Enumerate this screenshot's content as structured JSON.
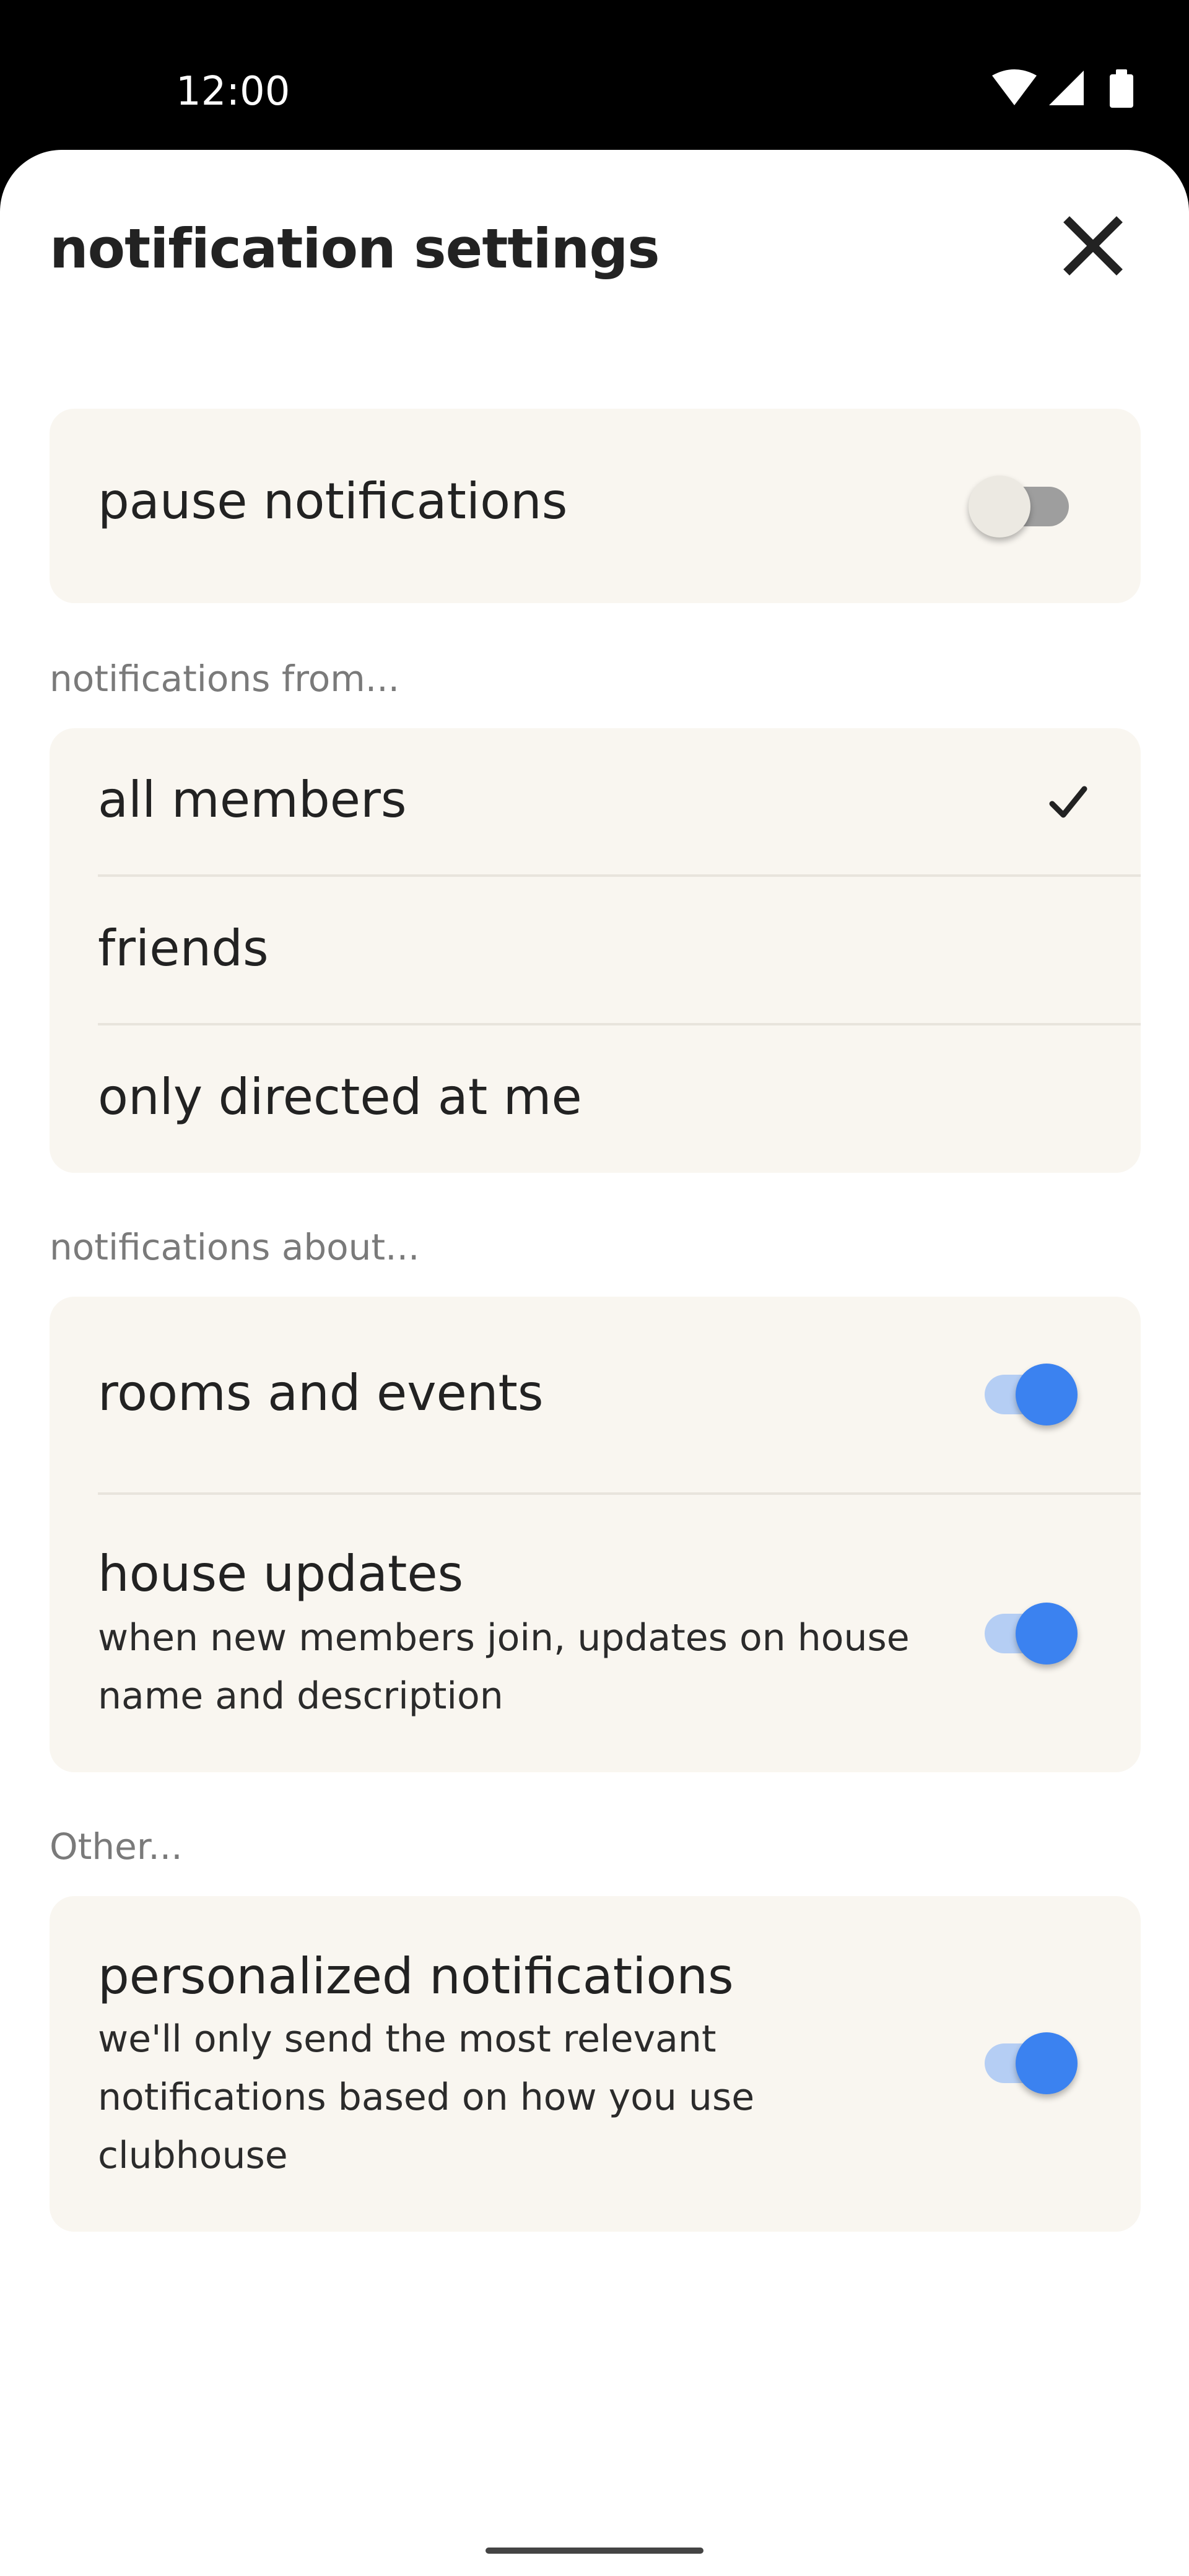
{
  "status_bar": {
    "time": "12:00",
    "icons": [
      "wifi-icon",
      "cellular-signal-icon",
      "battery-icon"
    ]
  },
  "header": {
    "title": "notification settings",
    "close_icon": "close-icon"
  },
  "pause": {
    "label": "pause notifications",
    "enabled": false
  },
  "from_section": {
    "label": "notifications from...",
    "options": [
      {
        "label": "all members",
        "selected": true
      },
      {
        "label": "friends",
        "selected": false
      },
      {
        "label": "only directed at me",
        "selected": false
      }
    ]
  },
  "about_section": {
    "label": "notifications about...",
    "items": [
      {
        "label": "rooms and events",
        "enabled": true
      },
      {
        "label": "house updates",
        "description": "when new members join, updates on house name and description",
        "enabled": true
      }
    ]
  },
  "other_section": {
    "label": "Other...",
    "items": [
      {
        "label": "personalized notifications",
        "description": "we'll only send the most relevant notifications based on how you use clubhouse",
        "enabled": true
      }
    ]
  },
  "colors": {
    "card_background": "#f9f6f0",
    "toggle_on_knob": "#3b82f0",
    "toggle_on_track": "#b5cef4",
    "toggle_off_track": "#9e9e9e",
    "section_label": "#7a7a7a"
  }
}
